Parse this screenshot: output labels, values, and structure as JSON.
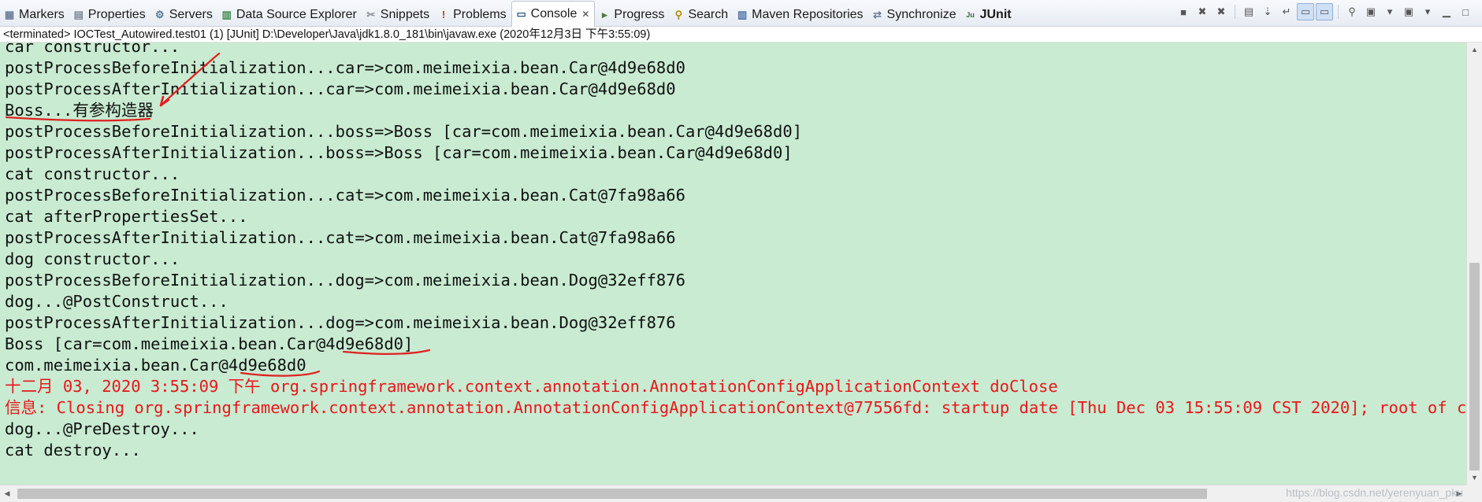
{
  "tabs": [
    {
      "label": "Markers",
      "icon": "markers-icon",
      "color": "#6a7f9a"
    },
    {
      "label": "Properties",
      "icon": "properties-icon",
      "color": "#7d8793"
    },
    {
      "label": "Servers",
      "icon": "servers-icon",
      "color": "#5c7a9a"
    },
    {
      "label": "Data Source Explorer",
      "icon": "data-source-icon",
      "color": "#3d8a4a"
    },
    {
      "label": "Snippets",
      "icon": "snippets-icon",
      "color": "#8a8f96"
    },
    {
      "label": "Problems",
      "icon": "problems-icon",
      "color": "#b03a2e"
    },
    {
      "label": "Console",
      "icon": "console-icon",
      "color": "#2c5a8c",
      "active": true,
      "closable": true
    },
    {
      "label": "Progress",
      "icon": "progress-icon",
      "color": "#4f7d3b"
    },
    {
      "label": "Search",
      "icon": "search-icon",
      "color": "#b8860b"
    },
    {
      "label": "Maven Repositories",
      "icon": "maven-icon",
      "color": "#4a6fa5"
    },
    {
      "label": "Synchronize",
      "icon": "synchronize-icon",
      "color": "#6e7f93"
    },
    {
      "label": "JUnit",
      "icon": "junit-icon",
      "color": "#2e6b2e",
      "bold": true
    }
  ],
  "status_line": "<terminated> IOCTest_Autowired.test01 (1) [JUnit] D:\\Developer\\Java\\jdk1.8.0_181\\bin\\javaw.exe (2020年12月3日 下午3:55:09)",
  "console_lines": [
    {
      "text": "car constructor...",
      "type": "out"
    },
    {
      "text": "postProcessBeforeInitialization...car=>com.meimeixia.bean.Car@4d9e68d0",
      "type": "out"
    },
    {
      "text": "postProcessAfterInitialization...car=>com.meimeixia.bean.Car@4d9e68d0",
      "type": "out"
    },
    {
      "text": "Boss...有参构造器",
      "type": "out"
    },
    {
      "text": "postProcessBeforeInitialization...boss=>Boss [car=com.meimeixia.bean.Car@4d9e68d0]",
      "type": "out"
    },
    {
      "text": "postProcessAfterInitialization...boss=>Boss [car=com.meimeixia.bean.Car@4d9e68d0]",
      "type": "out"
    },
    {
      "text": "cat constructor...",
      "type": "out"
    },
    {
      "text": "postProcessBeforeInitialization...cat=>com.meimeixia.bean.Cat@7fa98a66",
      "type": "out"
    },
    {
      "text": "cat afterPropertiesSet...",
      "type": "out"
    },
    {
      "text": "postProcessAfterInitialization...cat=>com.meimeixia.bean.Cat@7fa98a66",
      "type": "out"
    },
    {
      "text": "dog constructor...",
      "type": "out"
    },
    {
      "text": "postProcessBeforeInitialization...dog=>com.meimeixia.bean.Dog@32eff876",
      "type": "out"
    },
    {
      "text": "dog...@PostConstruct...",
      "type": "out"
    },
    {
      "text": "postProcessAfterInitialization...dog=>com.meimeixia.bean.Dog@32eff876",
      "type": "out"
    },
    {
      "text": "Boss [car=com.meimeixia.bean.Car@4d9e68d0]",
      "type": "out"
    },
    {
      "text": "com.meimeixia.bean.Car@4d9e68d0",
      "type": "out"
    },
    {
      "text": "十二月 03, 2020 3:55:09 下午 org.springframework.context.annotation.AnnotationConfigApplicationContext doClose",
      "type": "err"
    },
    {
      "text": "信息: Closing org.springframework.context.annotation.AnnotationConfigApplicationContext@77556fd: startup date [Thu Dec 03 15:55:09 CST 2020]; root of context hierarchy",
      "type": "err"
    },
    {
      "text": "dog...@PreDestroy...",
      "type": "out"
    },
    {
      "text": "cat destroy...",
      "type": "out"
    }
  ],
  "watermark": "https://blog.csdn.net/yerenyuan_pku",
  "colors": {
    "console_bg": "#c8ebd1",
    "stdout": "#111111",
    "stderr": "#e8171b",
    "annotation": "#e02020"
  },
  "scroll": {
    "vertical_position": 0.45,
    "vertical_visible_fraction": 0.5,
    "horizontal_visible_fraction": 0.84
  }
}
